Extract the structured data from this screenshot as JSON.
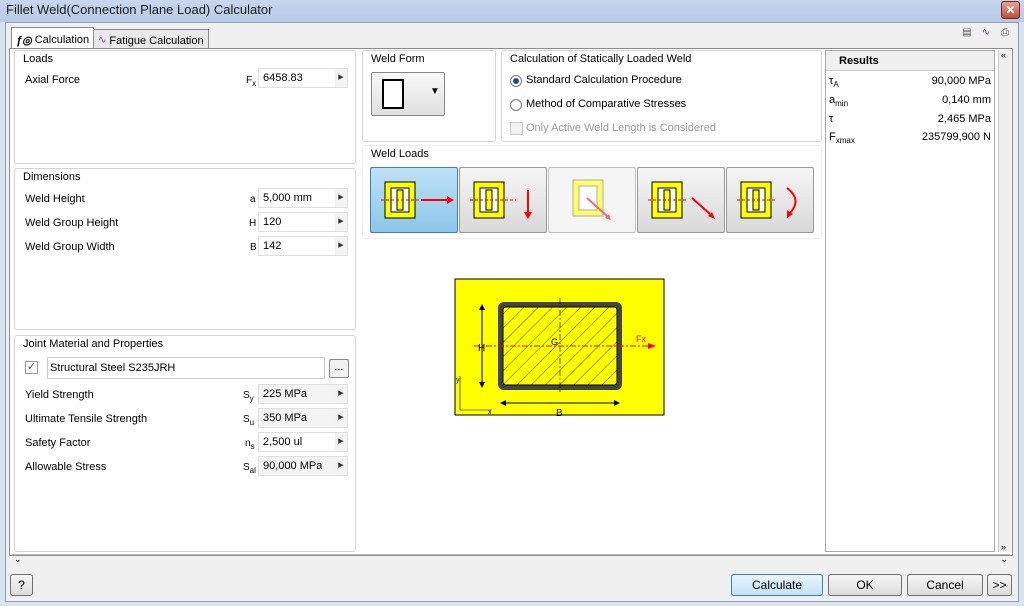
{
  "window": {
    "title": "Fillet Weld(Connection Plane Load) Calculator",
    "close": "✕"
  },
  "tabs": [
    {
      "label": "Calculation"
    },
    {
      "label": "Fatigue Calculation"
    }
  ],
  "loads": {
    "title": "Loads",
    "axial_label": "Axial Force",
    "axial_sym": "F",
    "axial_sub": "x",
    "axial_value": "6458.83"
  },
  "dimensions": {
    "title": "Dimensions",
    "rows": [
      {
        "label": "Weld Height",
        "sym": "a",
        "sub": "",
        "value": "5,000 mm"
      },
      {
        "label": "Weld Group Height",
        "sym": "H",
        "sub": "",
        "value": "120"
      },
      {
        "label": "Weld Group Width",
        "sym": "B",
        "sub": "",
        "value": "142"
      }
    ]
  },
  "material": {
    "title": "Joint Material and Properties",
    "name": "Structural Steel S235JRH",
    "browse": "...",
    "rows": [
      {
        "label": "Yield Strength",
        "sym": "S",
        "sub": "y",
        "value": "225 MPa"
      },
      {
        "label": "Ultimate Tensile Strength",
        "sym": "S",
        "sub": "u",
        "value": "350 MPa"
      },
      {
        "label": "Safety Factor",
        "sym": "n",
        "sub": "s",
        "value": "2,500 ul"
      },
      {
        "label": "Allowable Stress",
        "sym": "S",
        "sub": "al",
        "value": "90,000 MPa"
      }
    ]
  },
  "weld_form": {
    "title": "Weld Form"
  },
  "calc_method": {
    "title": "Calculation of Statically Loaded Weld",
    "option1": "Standard Calculation Procedure",
    "option2": "Method of Comparative Stresses",
    "option3": "Only Active Weld Length is Considered",
    "selected": "option1"
  },
  "weld_loads": {
    "title": "Weld Loads"
  },
  "diagram": {
    "label_h": "H",
    "label_b": "B",
    "label_g": "G",
    "label_fx": "Fx",
    "label_x": "x",
    "label_y": "y"
  },
  "results": {
    "title": "Results",
    "rows": [
      {
        "sym": "τ",
        "sub": "A",
        "value": "90,000 MPa"
      },
      {
        "sym": "a",
        "sub": "min",
        "value": "0,140 mm"
      },
      {
        "sym": "τ",
        "sub": "",
        "value": "2,465 MPa"
      },
      {
        "sym": "F",
        "sub": "xmax",
        "value": "235799,900 N"
      }
    ]
  },
  "buttons": {
    "help": "?",
    "calculate": "Calculate",
    "ok": "OK",
    "cancel": "Cancel",
    "more": ">>"
  },
  "colors": {
    "accent": "#3c7fb1",
    "diagram_fill": "#ffff00",
    "arrow": "#ff0000"
  }
}
